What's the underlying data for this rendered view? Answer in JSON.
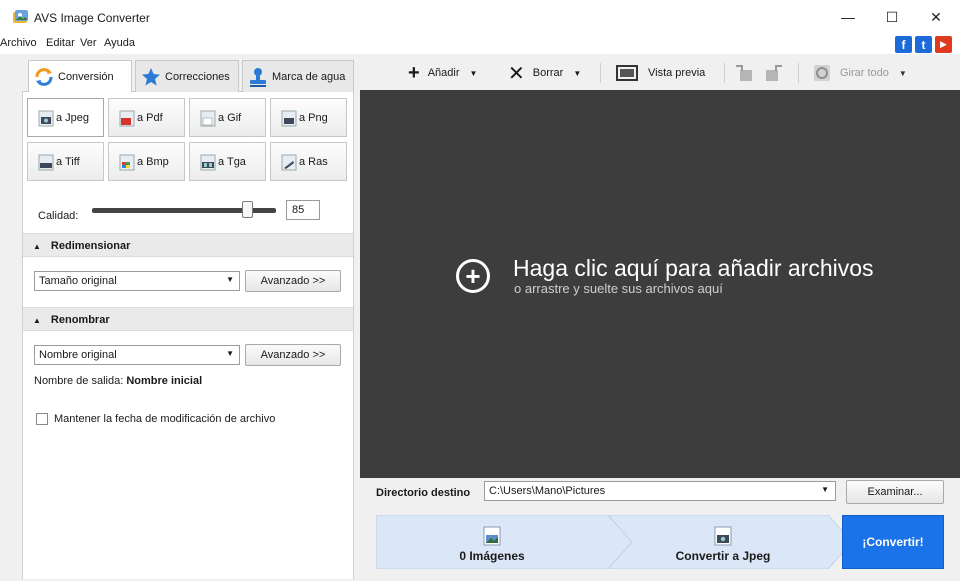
{
  "window": {
    "title": "AVS Image Converter",
    "controls": {
      "minimize": "—",
      "maximize": "☐",
      "close": "✕"
    }
  },
  "menu": [
    "Archivo",
    "Editar",
    "Ver",
    "Ayuda"
  ],
  "social": [
    {
      "name": "facebook",
      "glyph": "f",
      "color": "#1d6ad9"
    },
    {
      "name": "twitter",
      "glyph": "t",
      "color": "#1d6ad9"
    },
    {
      "name": "youtube",
      "glyph": "▶",
      "color": "#e03a1e"
    }
  ],
  "left_tabs": [
    {
      "label": "Conversión",
      "icon": "convert-icon",
      "active": true
    },
    {
      "label": "Correcciones",
      "icon": "star-icon",
      "active": false
    },
    {
      "label": "Marca de agua",
      "icon": "stamp-icon",
      "active": false
    }
  ],
  "formats": [
    {
      "label": "a Jpeg",
      "icon": "camera-icon",
      "active": true
    },
    {
      "label": "a Pdf",
      "icon": "pdf-icon",
      "active": false
    },
    {
      "label": "a Gif",
      "icon": "gif-icon",
      "active": false
    },
    {
      "label": "a Png",
      "icon": "monitor-icon",
      "active": false
    },
    {
      "label": "a Tiff",
      "icon": "printer-icon",
      "active": false
    },
    {
      "label": "a Bmp",
      "icon": "palette-icon",
      "active": false
    },
    {
      "label": "a Tga",
      "icon": "film-icon",
      "active": false
    },
    {
      "label": "a Ras",
      "icon": "brush-icon",
      "active": false
    }
  ],
  "quality": {
    "label": "Calidad:",
    "value": "85",
    "level_percent": 85
  },
  "resize": {
    "header": "Redimensionar",
    "select_value": "Tamaño original",
    "advanced": "Avanzado >>"
  },
  "rename": {
    "header": "Renombrar",
    "select_value": "Nombre original",
    "advanced": "Avanzado >>",
    "output_label": "Nombre de salida:",
    "output_value": "Nombre inicial"
  },
  "keep_date": {
    "label": "Mantener la fecha de modificación de archivo",
    "checked": false
  },
  "toolbar": {
    "add": "Añadir",
    "delete": "Borrar",
    "preview": "Vista previa",
    "rotate_all": "Girar todo"
  },
  "drop_area": {
    "main": "Haga clic aquí para añadir archivos",
    "sub": "o arrastre y suelte sus archivos aquí"
  },
  "destination": {
    "label": "Directorio destino",
    "path": "C:\\Users\\Mano\\Pictures",
    "browse": "Examinar..."
  },
  "steps": {
    "images": "0 Imágenes",
    "convert_to": "Convertir a Jpeg",
    "convert_button": "¡Convertir!"
  },
  "colors": {
    "accent": "#1a73e8",
    "drop_bg": "#3d3d3d",
    "step_bg": "#dbe6f7"
  }
}
